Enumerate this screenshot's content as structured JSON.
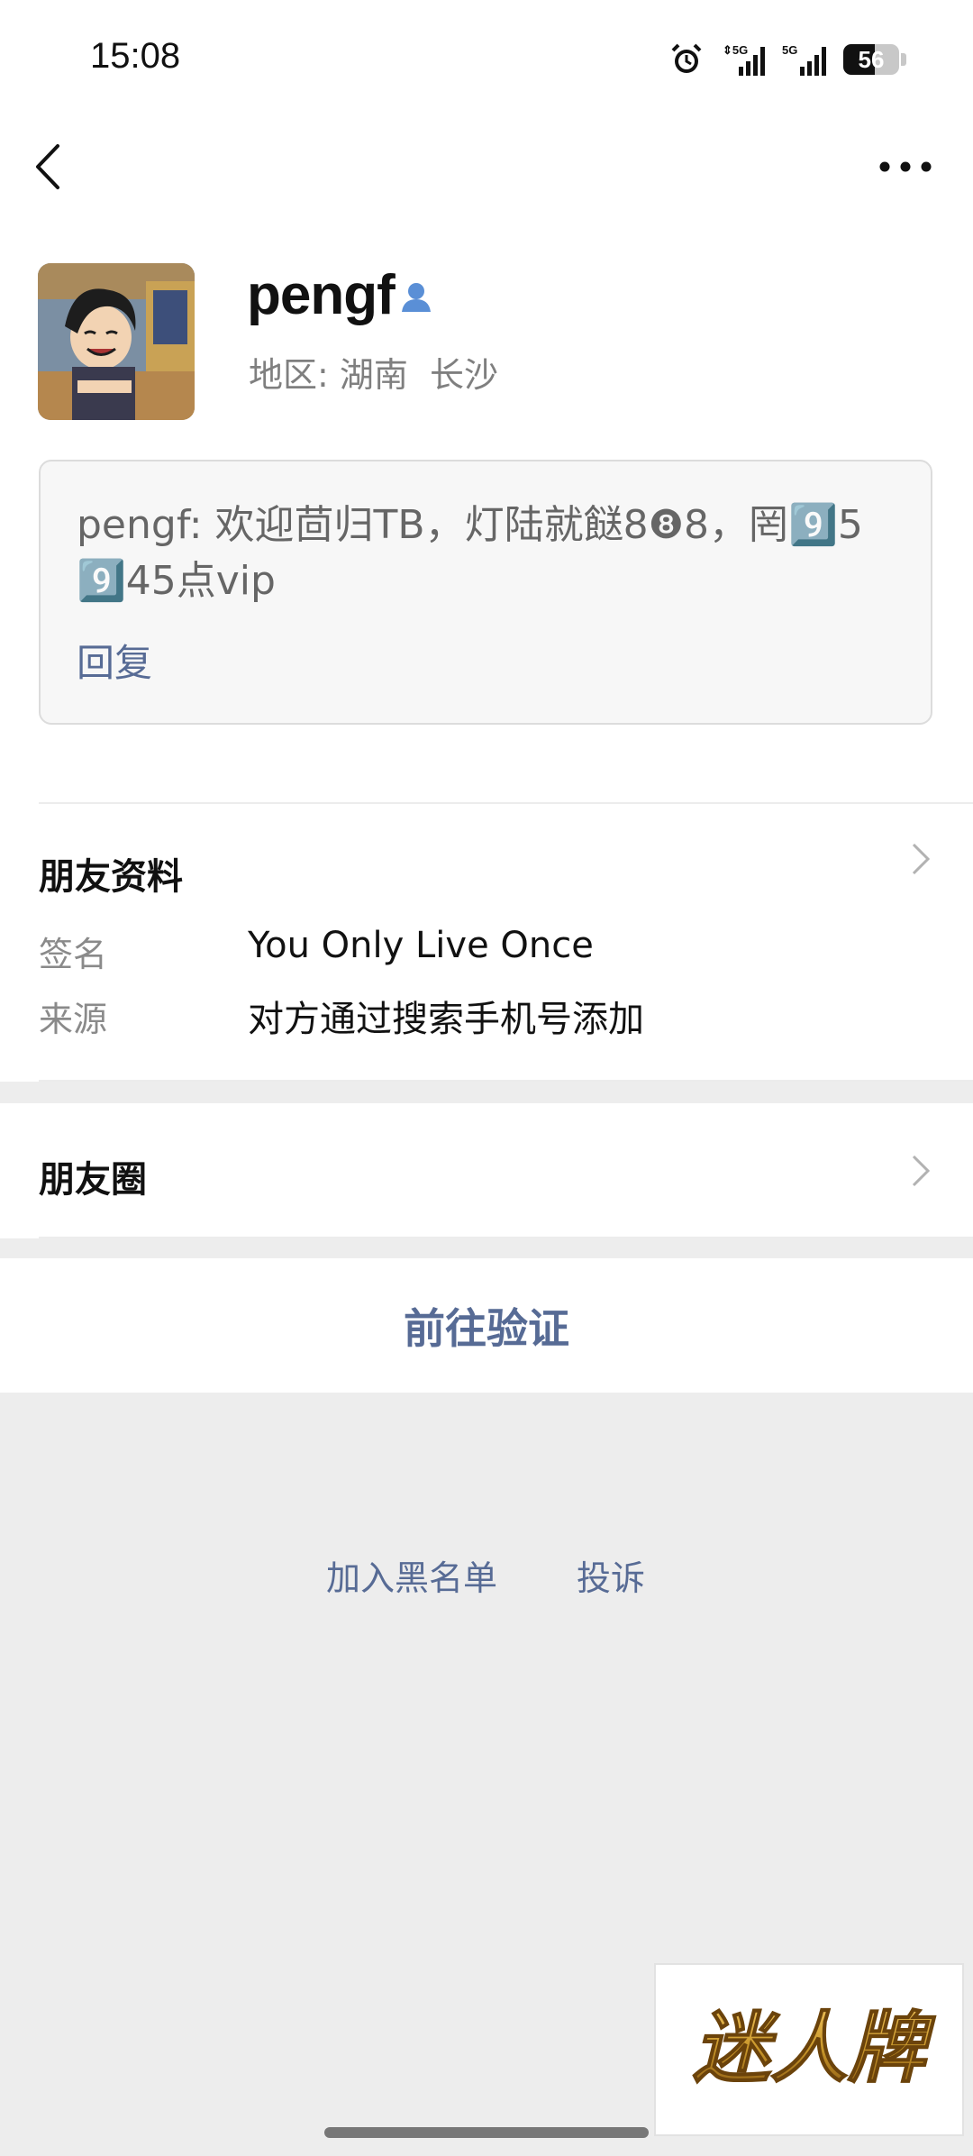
{
  "status_bar": {
    "time": "15:08",
    "icons": [
      "alarm-icon",
      "signal-5g-icon",
      "signal-5g-icon"
    ],
    "battery_level": "56"
  },
  "nav": {
    "back_icon": "chevron-left-icon",
    "more_icon": "more-dots-icon"
  },
  "profile": {
    "name": "pengf",
    "gender_icon": "person-icon",
    "region": "地区: 湖南  长沙"
  },
  "greeting": {
    "text": "pengf: 欢迎茴归TB，灯陆就餸8❽8，罔9️⃣5 9️⃣45点vip",
    "reply_label": "回复"
  },
  "friend_info": {
    "title": "朋友资料",
    "fields": [
      {
        "label": "签名",
        "value": "You Only Live Once"
      },
      {
        "label": "来源",
        "value": "对方通过搜索手机号添加"
      }
    ]
  },
  "moments": {
    "title": "朋友圈"
  },
  "actions": {
    "verify_label": "前往验证",
    "blacklist_label": "加入黑名单",
    "report_label": "投诉"
  },
  "watermark": {
    "text": "迷人牌"
  },
  "colors": {
    "link_blue": "#576b95",
    "background_gray": "#ededed",
    "watermark_gold": "#c8962a"
  }
}
